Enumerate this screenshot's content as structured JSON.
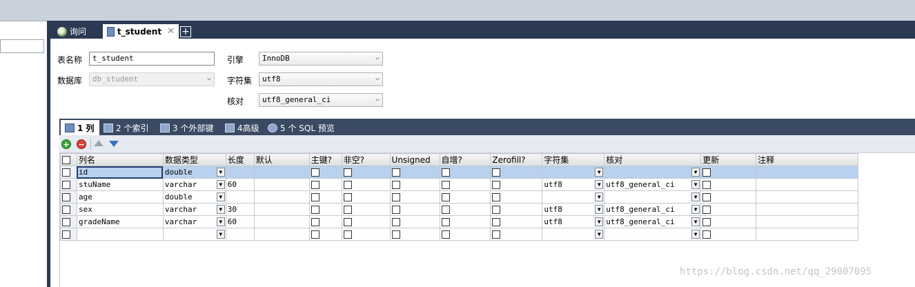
{
  "tabs": {
    "query": "询问",
    "table": "t_student",
    "close": "✕",
    "add": "+"
  },
  "form": {
    "table_name_label": "表名称",
    "table_name_value": "t_student",
    "database_label": "数据库",
    "database_value": "db_student",
    "engine_label": "引擎",
    "engine_value": "InnoDB",
    "charset_label": "字符集",
    "charset_value": "utf8",
    "collation_label": "核对",
    "collation_value": "utf8_general_ci"
  },
  "subtabs": {
    "columns": "1 列",
    "indexes": "2 个索引",
    "foreign_keys": "3 个外部键",
    "advanced": "4高级",
    "sql_preview": "5 个 SQL 预览"
  },
  "grid": {
    "headers": [
      "列名",
      "数据类型",
      "长度",
      "默认",
      "主键?",
      "非空?",
      "Unsigned",
      "自增?",
      "Zerofill?",
      "字符集",
      "核对",
      "更新",
      "注释"
    ],
    "rows": [
      {
        "name": "id",
        "type": "double",
        "length": "",
        "charset": "",
        "collation": ""
      },
      {
        "name": "stuName",
        "type": "varchar",
        "length": "60",
        "charset": "utf8",
        "collation": "utf8_general_ci"
      },
      {
        "name": "age",
        "type": "double",
        "length": "",
        "charset": "",
        "collation": ""
      },
      {
        "name": "sex",
        "type": "varchar",
        "length": "30",
        "charset": "utf8",
        "collation": "utf8_general_ci"
      },
      {
        "name": "gradeName",
        "type": "varchar",
        "length": "60",
        "charset": "utf8",
        "collation": "utf8_general_ci"
      },
      {
        "name": "",
        "type": "",
        "length": "",
        "charset": "",
        "collation": ""
      }
    ]
  },
  "watermark": "https://blog.csdn.net/qq_29007095",
  "colors": {
    "tab_bar": "#2b3a52",
    "subtab_bar": "#3a4a63",
    "selected_row": "#b9d1ee"
  }
}
